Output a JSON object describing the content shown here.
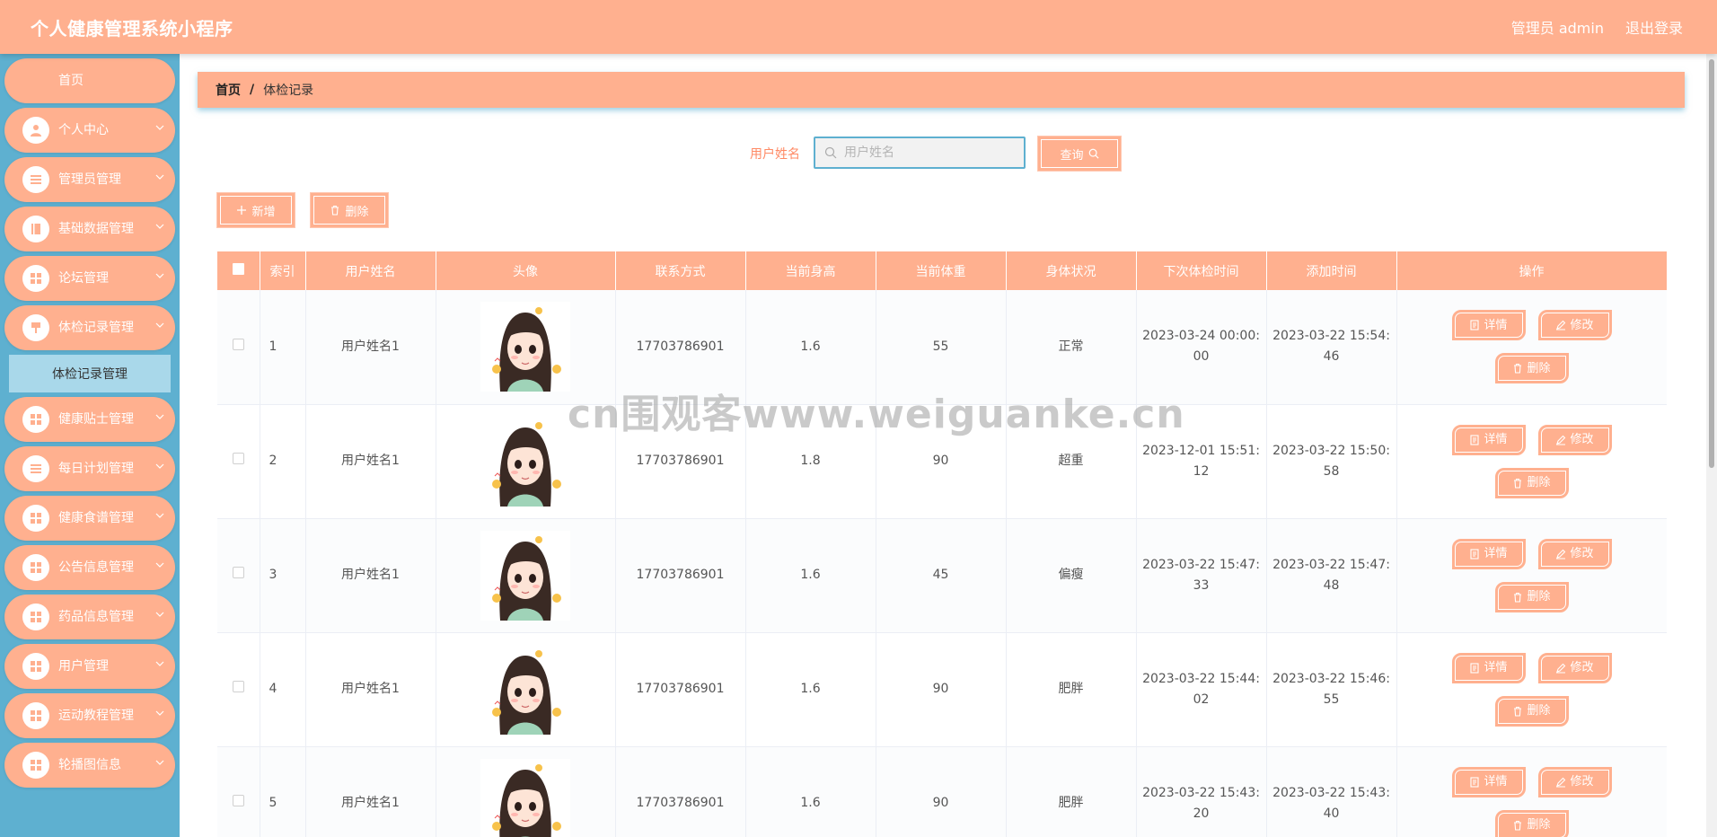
{
  "header": {
    "title": "个人健康管理系统小程序",
    "user": "管理员 admin",
    "logout": "退出登录"
  },
  "sidebar": {
    "items": [
      {
        "label": "首页",
        "icon": "none",
        "arrow": false
      },
      {
        "label": "个人中心",
        "icon": "user-icon",
        "arrow": true
      },
      {
        "label": "管理员管理",
        "icon": "list-icon",
        "arrow": true
      },
      {
        "label": "基础数据管理",
        "icon": "book-icon",
        "arrow": true
      },
      {
        "label": "论坛管理",
        "icon": "grid-icon",
        "arrow": true
      },
      {
        "label": "体检记录管理",
        "icon": "pin-icon",
        "arrow": true
      },
      {
        "label": "健康贴士管理",
        "icon": "grid-icon",
        "arrow": true
      },
      {
        "label": "每日计划管理",
        "icon": "list-icon",
        "arrow": true
      },
      {
        "label": "健康食谱管理",
        "icon": "grid-icon",
        "arrow": true
      },
      {
        "label": "公告信息管理",
        "icon": "grid-icon",
        "arrow": true
      },
      {
        "label": "药品信息管理",
        "icon": "grid-icon",
        "arrow": true
      },
      {
        "label": "用户管理",
        "icon": "grid-icon",
        "arrow": true
      },
      {
        "label": "运动教程管理",
        "icon": "grid-icon",
        "arrow": true
      },
      {
        "label": "轮播图信息",
        "icon": "grid-icon",
        "arrow": true
      }
    ],
    "submenu": "体检记录管理"
  },
  "breadcrumb": {
    "home": "首页",
    "sep": "/",
    "current": "体检记录"
  },
  "search": {
    "label": "用户姓名",
    "placeholder": "用户姓名",
    "button": "查询"
  },
  "actions": {
    "add": "新增",
    "delete": "删除"
  },
  "table": {
    "headers": [
      "索引",
      "用户姓名",
      "头像",
      "联系方式",
      "当前身高",
      "当前体重",
      "身体状况",
      "下次体检时间",
      "添加时间",
      "操作"
    ],
    "op_labels": {
      "detail": "详情",
      "edit": "修改",
      "delete": "删除"
    },
    "rows": [
      {
        "index": "1",
        "name": "用户姓名1",
        "phone": "17703786901",
        "height": "1.6",
        "weight": "55",
        "status": "正常",
        "next_a": "2023-03-24 00:00:",
        "next_b": "00",
        "add_a": "2023-03-22 15:54:",
        "add_b": "46"
      },
      {
        "index": "2",
        "name": "用户姓名1",
        "phone": "17703786901",
        "height": "1.8",
        "weight": "90",
        "status": "超重",
        "next_a": "2023-12-01 15:51:",
        "next_b": "12",
        "add_a": "2023-03-22 15:50:",
        "add_b": "58"
      },
      {
        "index": "3",
        "name": "用户姓名1",
        "phone": "17703786901",
        "height": "1.6",
        "weight": "45",
        "status": "偏瘦",
        "next_a": "2023-03-22 15:47:",
        "next_b": "33",
        "add_a": "2023-03-22 15:47:",
        "add_b": "48"
      },
      {
        "index": "4",
        "name": "用户姓名1",
        "phone": "17703786901",
        "height": "1.6",
        "weight": "90",
        "status": "肥胖",
        "next_a": "2023-03-22 15:44:",
        "next_b": "02",
        "add_a": "2023-03-22 15:46:",
        "add_b": "55"
      },
      {
        "index": "5",
        "name": "用户姓名1",
        "phone": "17703786901",
        "height": "1.6",
        "weight": "90",
        "status": "肥胖",
        "next_a": "2023-03-22 15:43:",
        "next_b": "20",
        "add_a": "2023-03-22 15:43:",
        "add_b": "40"
      }
    ]
  },
  "watermark": "cn围观客www.weiguanke.cn",
  "colors": {
    "primary": "#ffb08f",
    "sidebar": "#5eb0d0",
    "submenu": "#a9d8ea"
  }
}
